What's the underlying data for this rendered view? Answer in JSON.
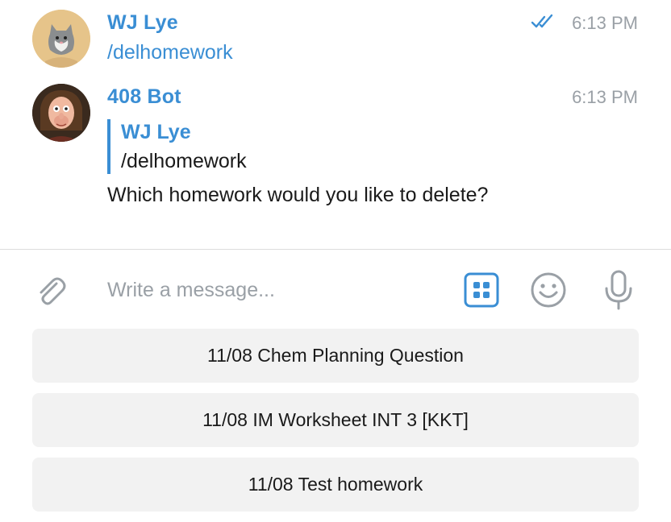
{
  "messages": [
    {
      "sender": "WJ Lye",
      "text": "/delhomework",
      "time": "6:13 PM",
      "status_icon": "double-check-icon",
      "avatar_icon": "cat-plush-avatar"
    },
    {
      "sender": "408 Bot",
      "time": "6:13 PM",
      "avatar_icon": "person-caricature-avatar",
      "reply": {
        "sender": "WJ Lye",
        "text": "/delhomework"
      },
      "text": "Which homework would you like to delete?"
    }
  ],
  "composer": {
    "placeholder": "Write a message...",
    "attach_icon": "paperclip-icon",
    "keyboard_icon": "bot-keyboard-icon",
    "emoji_icon": "emoji-icon",
    "mic_icon": "microphone-icon"
  },
  "keyboard": {
    "buttons": [
      {
        "label": "11/08 Chem Planning Question"
      },
      {
        "label": "11/08 IM Worksheet INT 3 [KKT]"
      },
      {
        "label": "11/08 Test homework"
      }
    ]
  },
  "colors": {
    "accent": "#3a8ed4",
    "muted": "#9aa0a6",
    "button_bg": "#f2f2f2",
    "text": "#1a1a1a"
  }
}
